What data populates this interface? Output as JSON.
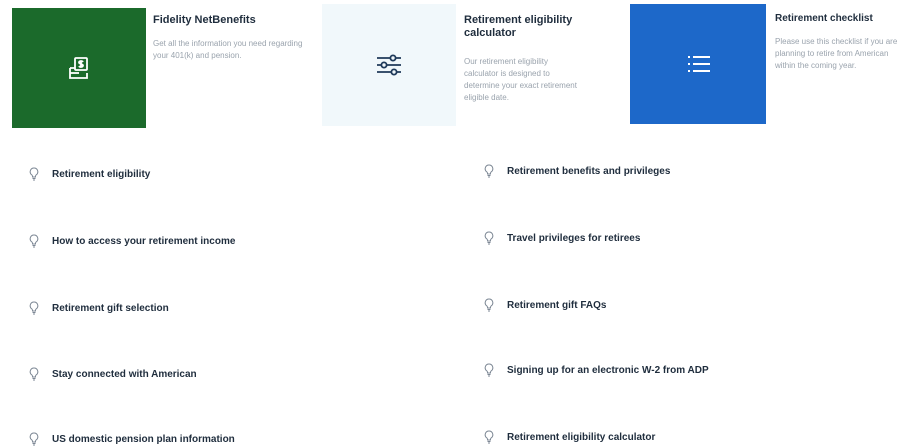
{
  "cards": [
    {
      "title": "Fidelity NetBenefits",
      "description": "Get all the information you need regarding your 401(k) and pension.",
      "icon": "document-dollar-icon"
    },
    {
      "title": "Retirement eligibility calculator",
      "description": "Our retirement eligibility calculator is designed to determine your exact retirement eligible date.",
      "icon": "sliders-icon"
    },
    {
      "title": "Retirement checklist",
      "description": "Please use this checklist if you are planning to retire from American within the coming year.",
      "icon": "list-icon"
    }
  ],
  "links": {
    "left": [
      "Retirement eligibility",
      "How to access your retirement income",
      "Retirement gift selection",
      "Stay connected with American",
      "US domestic pension plan information"
    ],
    "right": [
      "Retirement benefits and privileges",
      "Travel privileges for retirees",
      "Retirement gift FAQs",
      "Signing up for an electronic W-2 from ADP",
      "Retirement eligibility calculator"
    ],
    "icon": "lightbulb-icon"
  },
  "colors": {
    "green": "#1b6a2b",
    "light": "#f1f8fb",
    "blue": "#1d68c9",
    "text": "#1f2d3d"
  }
}
